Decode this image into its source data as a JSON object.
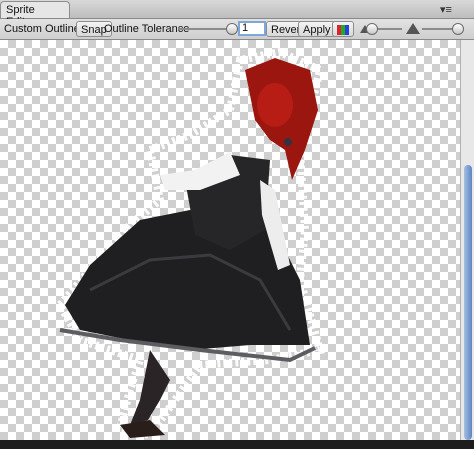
{
  "window": {
    "tab_title": "Sprite Editor"
  },
  "toolbar": {
    "mode_label": "Custom Outline ↕",
    "snap_label": "Snap",
    "tolerance_label": "Outline Tolerance",
    "tolerance_value": "1",
    "revert_label": "Revert",
    "apply_label": "Apply"
  },
  "icons": {
    "rgb_toggle": "color-channels-icon",
    "zoom_min": "small-mountain-icon",
    "zoom_max": "large-mountain-icon"
  }
}
